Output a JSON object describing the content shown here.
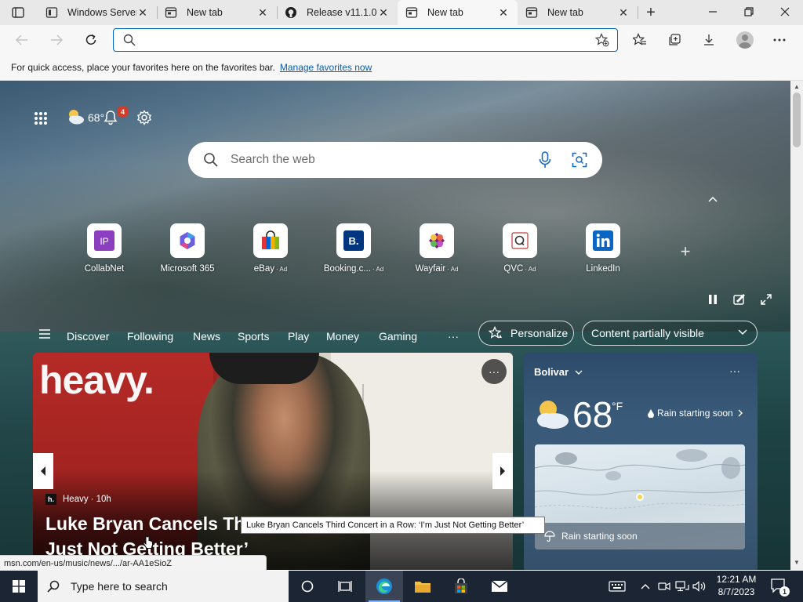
{
  "browser": {
    "tabs": [
      {
        "title": "Windows Server",
        "icon": "page-icon",
        "active": false
      },
      {
        "title": "New tab",
        "icon": "newtab-icon",
        "active": false
      },
      {
        "title": "Release v11.1.0",
        "icon": "github-icon",
        "active": false
      },
      {
        "title": "New tab",
        "icon": "newtab-icon",
        "active": true
      },
      {
        "title": "New tab",
        "icon": "newtab-icon",
        "active": false
      }
    ],
    "address": {
      "value": "",
      "placeholder": ""
    },
    "favorites_bar": {
      "message": "For quick access, place your favorites here on the favorites bar.",
      "link": "Manage favorites now"
    }
  },
  "newtab": {
    "weather_mini": {
      "temp": "68°",
      "notification_count": "4"
    },
    "search": {
      "placeholder": "Search the web"
    },
    "quick_links": [
      {
        "label": "CollabNet",
        "ad": ""
      },
      {
        "label": "Microsoft 365",
        "ad": ""
      },
      {
        "label": "eBay",
        "ad": "· Ad"
      },
      {
        "label": "Booking.c...",
        "ad": "· Ad"
      },
      {
        "label": "Wayfair",
        "ad": "· Ad"
      },
      {
        "label": "QVC",
        "ad": "· Ad"
      },
      {
        "label": "LinkedIn",
        "ad": ""
      }
    ],
    "feed_nav": {
      "items": [
        "Discover",
        "Following",
        "News",
        "Sports",
        "Play",
        "Money",
        "Gaming"
      ],
      "more": "···",
      "personalize": "Personalize",
      "visibility": "Content partially visible"
    },
    "hero": {
      "logo": "heavy.",
      "source": "Heavy",
      "source_icon": "h.",
      "age": "· 10h",
      "title": "Luke Bryan Cancels Third Concert in a Row: ‘I’m Just Not Getting Better’"
    },
    "weather_card": {
      "location": "Bolivar",
      "temp": "68",
      "unit": "°F",
      "summary": "Rain starting soon",
      "map_caption": "Rain starting soon"
    },
    "tooltip": "Luke Bryan Cancels Third Concert in a Row: ‘I’m Just Not Getting Better’",
    "status_url": "msn.com/en-us/music/news/.../ar-AA1eSioZ"
  },
  "taskbar": {
    "search_placeholder": "Type here to search",
    "time": "12:21 AM",
    "date": "8/7/2023",
    "notification_count": "1"
  },
  "colors": {
    "accent": "#0067c0",
    "taskbar": "#1c2533",
    "badge": "#d13d2a"
  }
}
